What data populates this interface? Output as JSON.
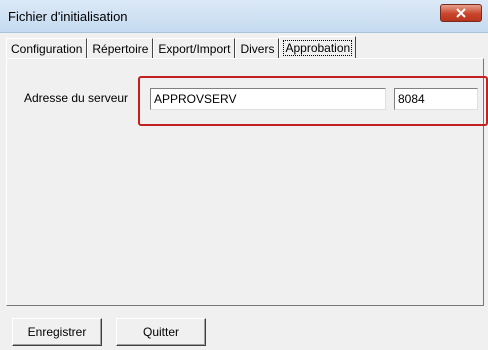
{
  "window": {
    "title": "Fichier d'initialisation"
  },
  "tabs": [
    {
      "label": "Configuration"
    },
    {
      "label": "Répertoire"
    },
    {
      "label": "Export/Import"
    },
    {
      "label": "Divers"
    },
    {
      "label": "Approbation"
    }
  ],
  "active_tab": "Approbation",
  "server": {
    "label": "Adresse du serveur",
    "address_value": "APPROVSERV",
    "port_value": "8084"
  },
  "buttons": {
    "save_label": "Enregistrer",
    "quit_label": "Quitter"
  },
  "colors": {
    "highlight": "#c42020",
    "close_button": "#c9452b"
  },
  "icons": {
    "close": "close-icon"
  }
}
